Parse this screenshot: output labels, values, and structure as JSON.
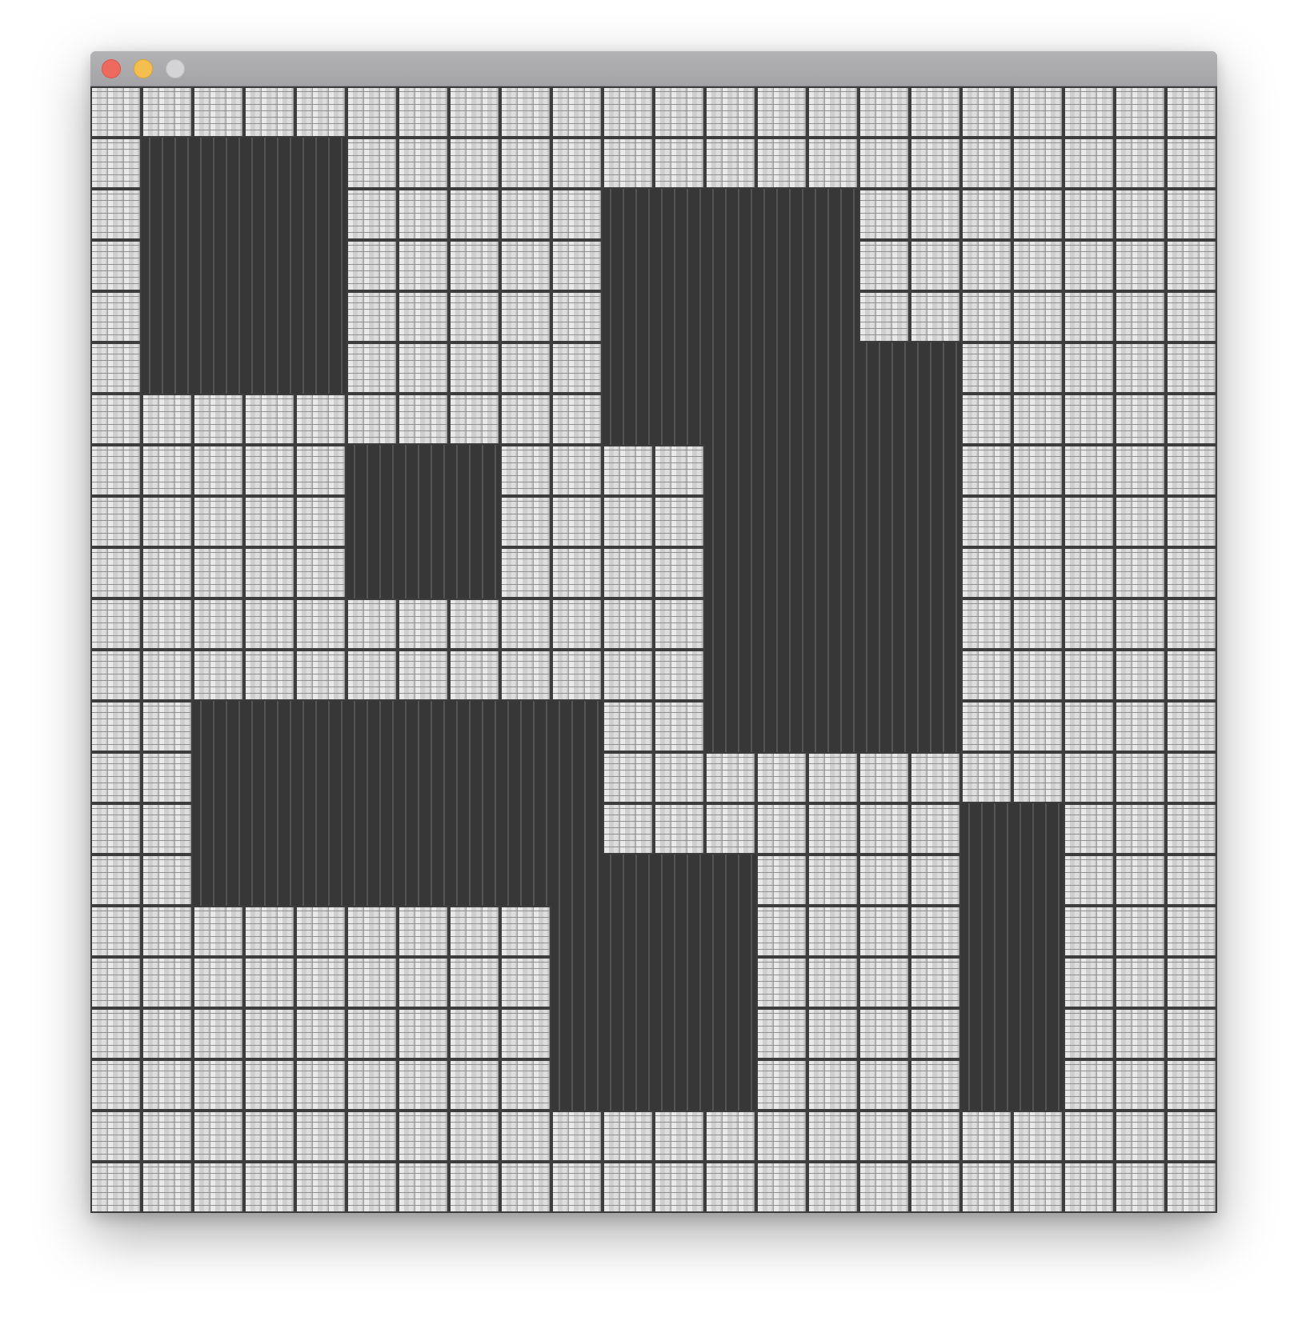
{
  "window": {
    "buttons": [
      "close",
      "minimize",
      "zoom"
    ]
  },
  "legend": {
    "wall": "#",
    "floor": "."
  },
  "map": {
    "rows": [
      "######################",
      "#....#################",
      "#....######.....######",
      "#....######.....######",
      "#....######.....######",
      "#....######.......####",
      "###########.......####",
      "#######...####.....###",
      "#######...####.....###",
      "##############.....###",
      "##############.....###",
      "###.........##.....###",
      "###.........#########",
      "###.........######..###",
      "###.........####...###",
      "###.........######..###",
      "##########....####..###",
      "##########....####..###",
      "##########....####..###",
      "##########....####..###",
      "######################",
      "######################"
    ]
  }
}
